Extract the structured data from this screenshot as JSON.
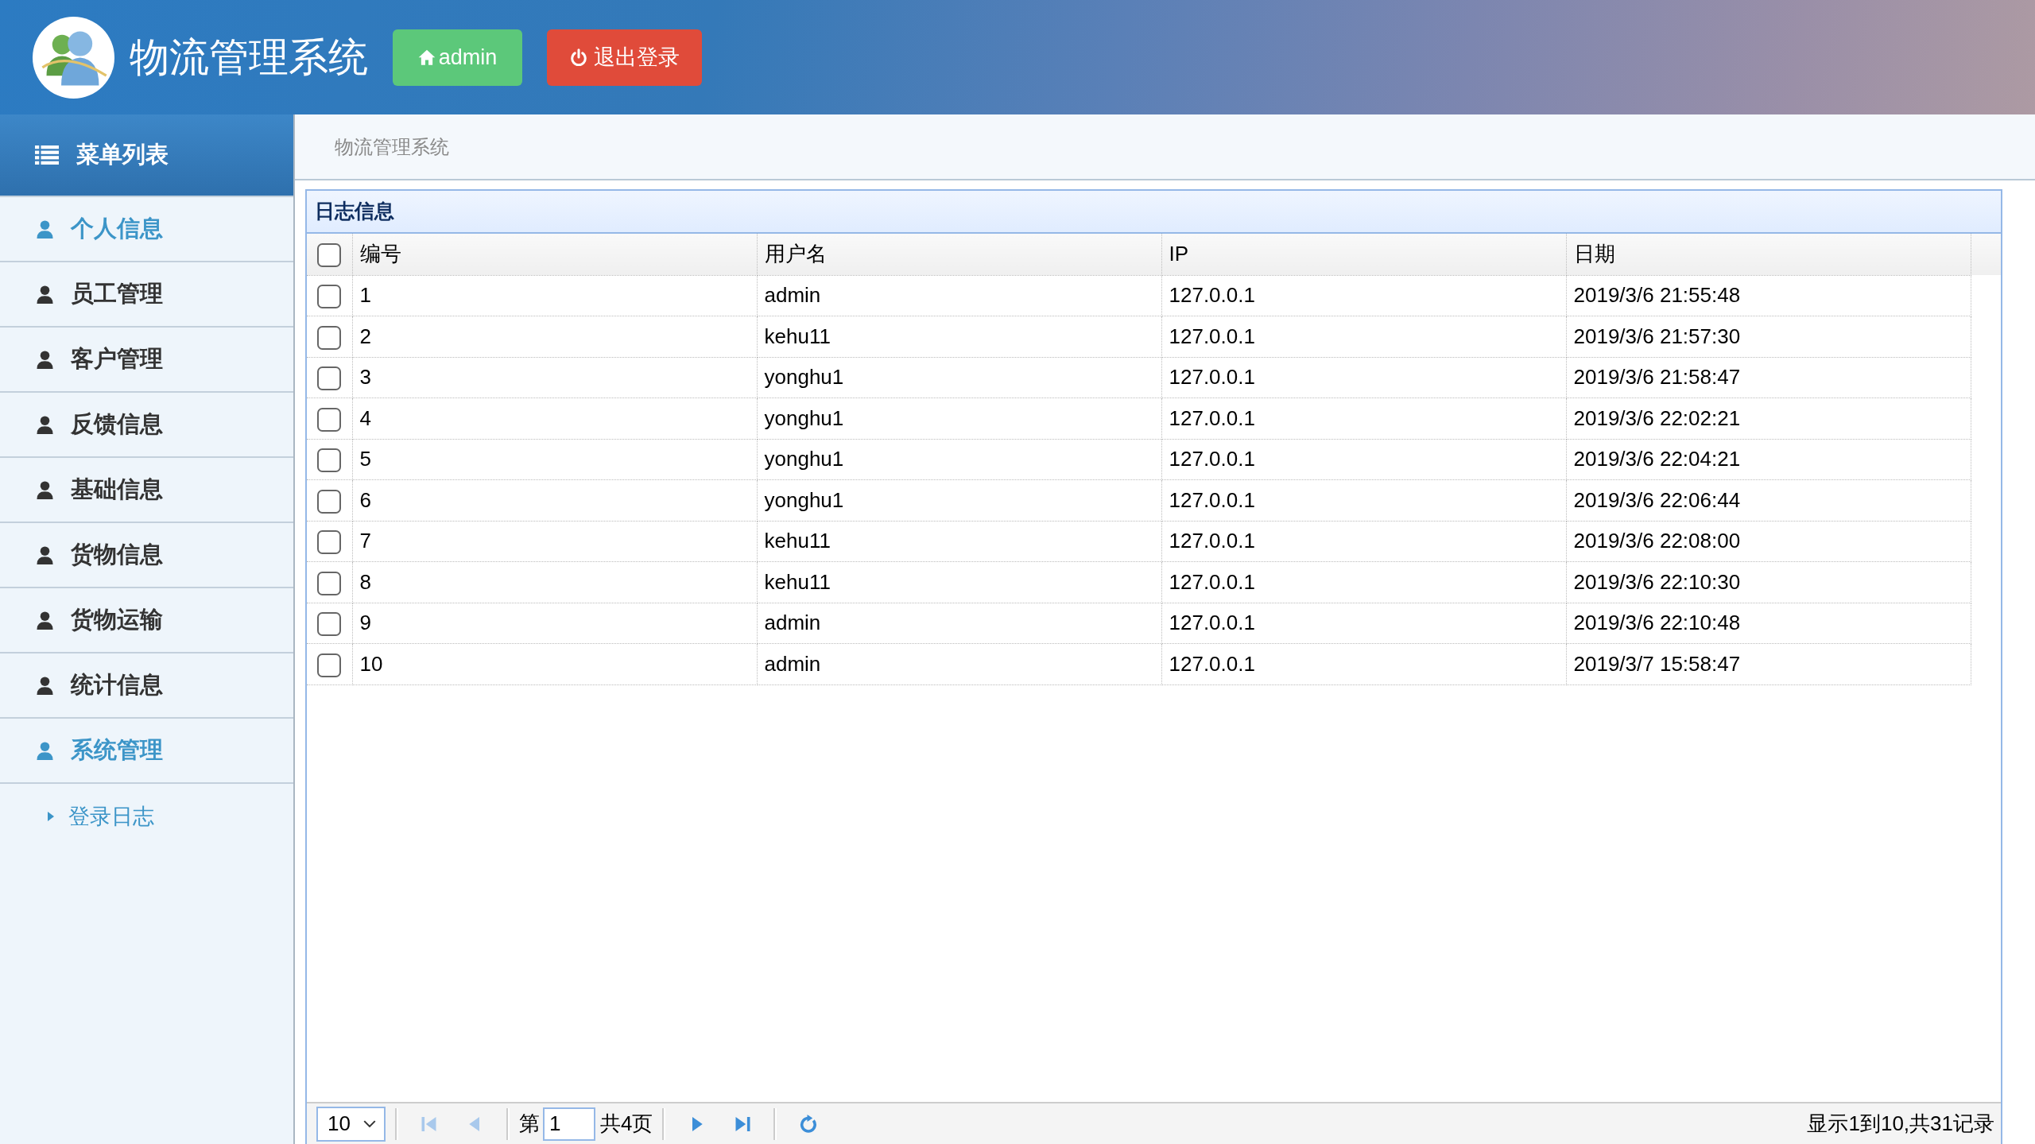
{
  "header": {
    "title": "物流管理系统",
    "user_button": "admin",
    "logout_button": "退出登录"
  },
  "sidebar": {
    "title": "菜单列表",
    "items": [
      {
        "label": "个人信息",
        "selected": true
      },
      {
        "label": "员工管理",
        "selected": false
      },
      {
        "label": "客户管理",
        "selected": false
      },
      {
        "label": "反馈信息",
        "selected": false
      },
      {
        "label": "基础信息",
        "selected": false
      },
      {
        "label": "货物信息",
        "selected": false
      },
      {
        "label": "货物运输",
        "selected": false
      },
      {
        "label": "统计信息",
        "selected": false
      },
      {
        "label": "系统管理",
        "selected": true,
        "children": [
          {
            "label": "登录日志",
            "selected": true
          }
        ]
      }
    ]
  },
  "breadcrumb": "物流管理系统",
  "panel": {
    "title": "日志信息",
    "table": {
      "header_checked": false,
      "columns": [
        "编号",
        "用户名",
        "IP",
        "日期"
      ],
      "rows": [
        {
          "checked": false,
          "cells": [
            "1",
            "admin",
            "127.0.0.1",
            "2019/3/6 21:55:48"
          ]
        },
        {
          "checked": false,
          "cells": [
            "2",
            "kehu11",
            "127.0.0.1",
            "2019/3/6 21:57:30"
          ]
        },
        {
          "checked": false,
          "cells": [
            "3",
            "yonghu1",
            "127.0.0.1",
            "2019/3/6 21:58:47"
          ]
        },
        {
          "checked": false,
          "cells": [
            "4",
            "yonghu1",
            "127.0.0.1",
            "2019/3/6 22:02:21"
          ]
        },
        {
          "checked": false,
          "cells": [
            "5",
            "yonghu1",
            "127.0.0.1",
            "2019/3/6 22:04:21"
          ]
        },
        {
          "checked": false,
          "cells": [
            "6",
            "yonghu1",
            "127.0.0.1",
            "2019/3/6 22:06:44"
          ]
        },
        {
          "checked": false,
          "cells": [
            "7",
            "kehu11",
            "127.0.0.1",
            "2019/3/6 22:08:00"
          ]
        },
        {
          "checked": false,
          "cells": [
            "8",
            "kehu11",
            "127.0.0.1",
            "2019/3/6 22:10:30"
          ]
        },
        {
          "checked": false,
          "cells": [
            "9",
            "admin",
            "127.0.0.1",
            "2019/3/6 22:10:48"
          ]
        },
        {
          "checked": false,
          "cells": [
            "10",
            "admin",
            "127.0.0.1",
            "2019/3/7 15:58:47"
          ]
        }
      ]
    }
  },
  "pager": {
    "page_size": "10",
    "buttons_before": [
      {
        "kind": "first",
        "disabled": true
      },
      {
        "kind": "prev",
        "disabled": true
      }
    ],
    "page_prefix": "第",
    "page": "1",
    "page_suffix": "共4页",
    "buttons_after": [
      {
        "kind": "next",
        "disabled": false
      },
      {
        "kind": "last",
        "disabled": false
      }
    ],
    "summary": "显示1到10,共31记录"
  }
}
